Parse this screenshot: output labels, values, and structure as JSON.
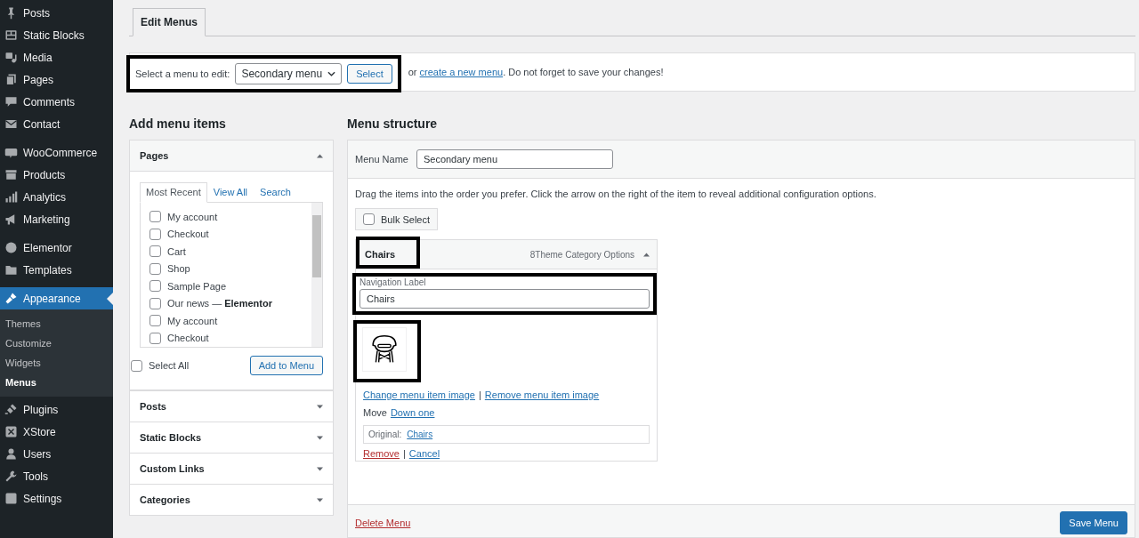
{
  "sidebar": {
    "groups": [
      {
        "items": [
          {
            "label": "Posts",
            "selected": false
          },
          {
            "label": "Static Blocks",
            "selected": false
          },
          {
            "label": "Media",
            "selected": false
          },
          {
            "label": "Pages",
            "selected": false
          },
          {
            "label": "Comments",
            "selected": false
          },
          {
            "label": "Contact",
            "selected": false
          }
        ]
      },
      {
        "items": [
          {
            "label": "WooCommerce",
            "selected": false
          },
          {
            "label": "Products",
            "selected": false
          },
          {
            "label": "Analytics",
            "selected": false
          },
          {
            "label": "Marketing",
            "selected": false
          }
        ]
      },
      {
        "items": [
          {
            "label": "Elementor",
            "selected": false
          },
          {
            "label": "Templates",
            "selected": false
          }
        ]
      },
      {
        "items": [
          {
            "label": "Appearance",
            "selected": true,
            "children": [
              {
                "label": "Themes",
                "selected": false
              },
              {
                "label": "Customize",
                "selected": false
              },
              {
                "label": "Widgets",
                "selected": false
              },
              {
                "label": "Menus",
                "selected": true
              }
            ]
          },
          {
            "label": "Plugins",
            "selected": false
          },
          {
            "label": "XStore",
            "selected": false
          },
          {
            "label": "Users",
            "selected": false
          },
          {
            "label": "Tools",
            "selected": false
          },
          {
            "label": "Settings",
            "selected": false
          }
        ]
      }
    ]
  },
  "tabs": [
    {
      "label": "Edit Menus",
      "selected": true
    }
  ],
  "select_bar": {
    "label": "Select a menu to edit:",
    "dropdown": "Secondary menu",
    "button": "Select",
    "text_before": "or",
    "link": "create a new menu",
    "text_after": ". Do not forget to save your changes!"
  },
  "add_items": {
    "heading": "Add menu items",
    "sections": [
      {
        "title": "Pages",
        "expanded": true,
        "tabs": [
          {
            "label": "Most Recent",
            "selected": true
          },
          {
            "label": "View All",
            "selected": false
          },
          {
            "label": "Search",
            "selected": false
          }
        ],
        "items": [
          {
            "label": "My account",
            "checked": false
          },
          {
            "label": "Checkout",
            "checked": false
          },
          {
            "label": "Cart",
            "checked": false
          },
          {
            "label": "Shop",
            "checked": false
          },
          {
            "label": "Sample Page",
            "checked": false
          },
          {
            "label": "Our news — **Elementor**",
            "checked": false
          },
          {
            "label": "My account",
            "checked": false
          },
          {
            "label": "Checkout",
            "checked": false
          }
        ],
        "select_all": {
          "label": "Select All",
          "checked": false
        },
        "add_button": "Add to Menu"
      },
      {
        "title": "Posts",
        "expanded": false
      },
      {
        "title": "Static Blocks",
        "expanded": false
      },
      {
        "title": "Custom Links",
        "expanded": false
      },
      {
        "title": "Categories",
        "expanded": false
      }
    ]
  },
  "menu_structure": {
    "heading": "Menu structure",
    "menu_name_label": "Menu Name",
    "menu_name": "Secondary menu",
    "instructions": "Drag the items into the order you prefer. Click the arrow on the right of the item to reveal additional configuration options.",
    "bulk_select": {
      "label": "Bulk Select",
      "checked": false
    },
    "items": [
      {
        "title": "Chairs",
        "type_label": "8Theme Category Options",
        "expanded": true,
        "nav_label_caption": "Navigation Label",
        "nav_label": "Chairs",
        "image_links": [
          "Change menu item image",
          "Remove menu item image"
        ],
        "link_separator": "|",
        "move_label": "Move",
        "move_links": [
          "Down one"
        ],
        "original_label": "Original:",
        "original_link": "Chairs",
        "remove": "Remove",
        "cancel": "Cancel"
      }
    ],
    "delete": "Delete Menu",
    "save": "Save Menu"
  }
}
